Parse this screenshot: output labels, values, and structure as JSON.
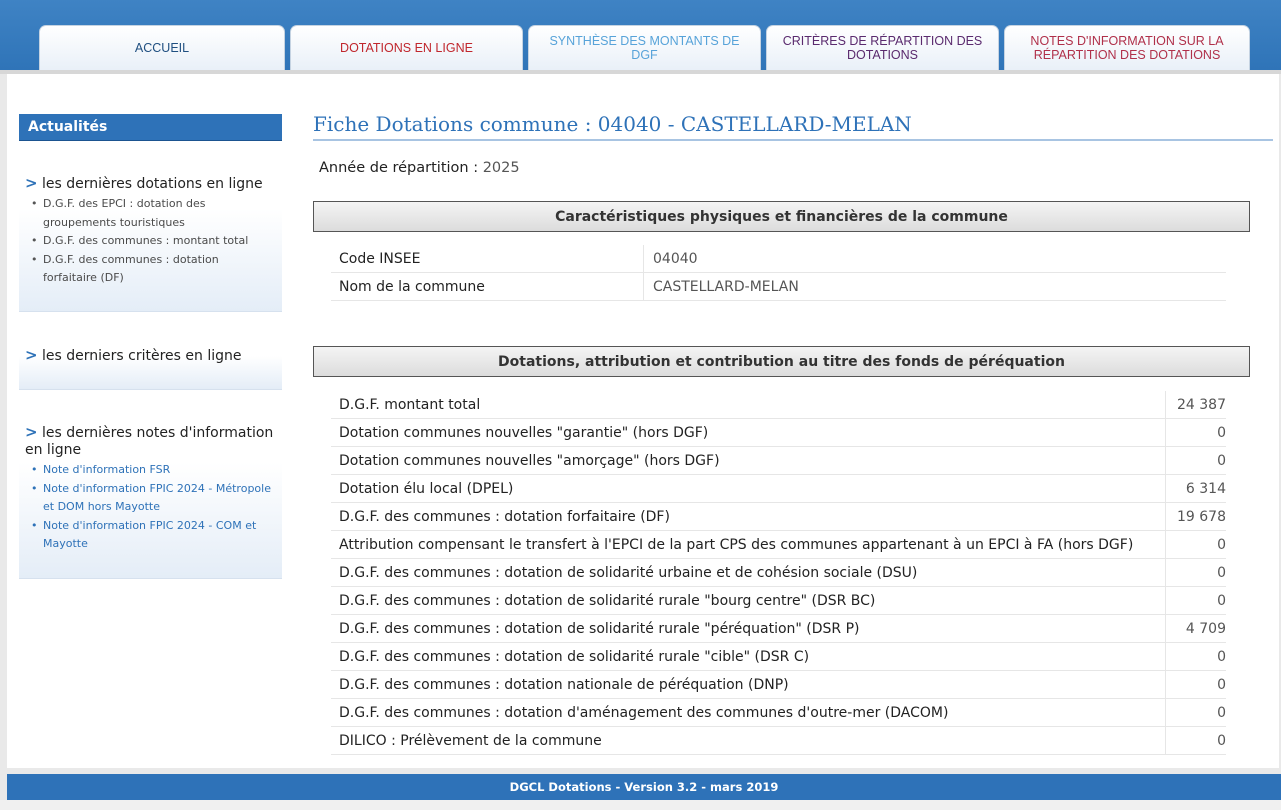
{
  "nav": {
    "tabs": [
      {
        "label": "ACCUEIL"
      },
      {
        "label": "DOTATIONS EN LIGNE"
      },
      {
        "label": "SYNTHÈSE DES MONTANTS DE DGF"
      },
      {
        "label": "CRITÈRES DE RÉPARTITION DES DOTATIONS"
      },
      {
        "label": "NOTES D'INFORMATION SUR LA RÉPARTITION DES DOTATIONS"
      }
    ]
  },
  "sidebar": {
    "title": "Actualités",
    "blocks": [
      {
        "head": "les dernières dotations en ligne",
        "items": [
          "D.G.F. des EPCI : dotation des groupements touristiques",
          "D.G.F. des communes : montant total",
          "D.G.F. des communes : dotation forfaitaire (DF)"
        ]
      },
      {
        "head": "les derniers critères en ligne",
        "items": []
      },
      {
        "head": "les dernières notes d'information en ligne",
        "items": [
          "Note d'information FSR",
          "Note d'information FPIC 2024 - Métropole et DOM hors Mayotte",
          "Note d'information FPIC 2024 - COM et Mayotte"
        ]
      }
    ]
  },
  "main": {
    "title": "Fiche Dotations commune : 04040 - CASTELLARD-MELAN",
    "year_label": "Année de répartition :",
    "year_value": "2025",
    "section1": {
      "title": "Caractéristiques physiques et financières de la commune",
      "rows": [
        {
          "label": "Code INSEE",
          "value": "04040"
        },
        {
          "label": "Nom de la commune",
          "value": "CASTELLARD-MELAN"
        }
      ]
    },
    "section2": {
      "title": "Dotations, attribution et contribution au titre des fonds de péréquation",
      "rows": [
        {
          "label": "D.G.F. montant total",
          "value": "24 387"
        },
        {
          "label": "Dotation communes nouvelles \"garantie\" (hors DGF)",
          "value": "0"
        },
        {
          "label": "Dotation communes nouvelles \"amorçage\" (hors DGF)",
          "value": "0"
        },
        {
          "label": "Dotation élu local (DPEL)",
          "value": "6 314"
        },
        {
          "label": "D.G.F. des communes : dotation forfaitaire (DF)",
          "value": "19 678"
        },
        {
          "label": "Attribution compensant le transfert à l'EPCI de la part CPS des communes appartenant à un EPCI à FA (hors DGF)",
          "value": "0"
        },
        {
          "label": "D.G.F. des communes : dotation de solidarité urbaine et de cohésion sociale (DSU)",
          "value": "0"
        },
        {
          "label": "D.G.F. des communes : dotation de solidarité rurale \"bourg centre\" (DSR BC)",
          "value": "0"
        },
        {
          "label": "D.G.F. des communes : dotation de solidarité rurale \"péréquation\" (DSR P)",
          "value": "4 709"
        },
        {
          "label": "D.G.F. des communes : dotation de solidarité rurale \"cible\" (DSR C)",
          "value": "0"
        },
        {
          "label": "D.G.F. des communes : dotation nationale de péréquation (DNP)",
          "value": "0"
        },
        {
          "label": "D.G.F. des communes : dotation d'aménagement des communes d'outre-mer (DACOM)",
          "value": "0"
        },
        {
          "label": "DILICO : Prélèvement de la commune",
          "value": "0"
        }
      ]
    }
  },
  "footer": {
    "text": "DGCL Dotations - Version 3.2 - mars 2019"
  }
}
